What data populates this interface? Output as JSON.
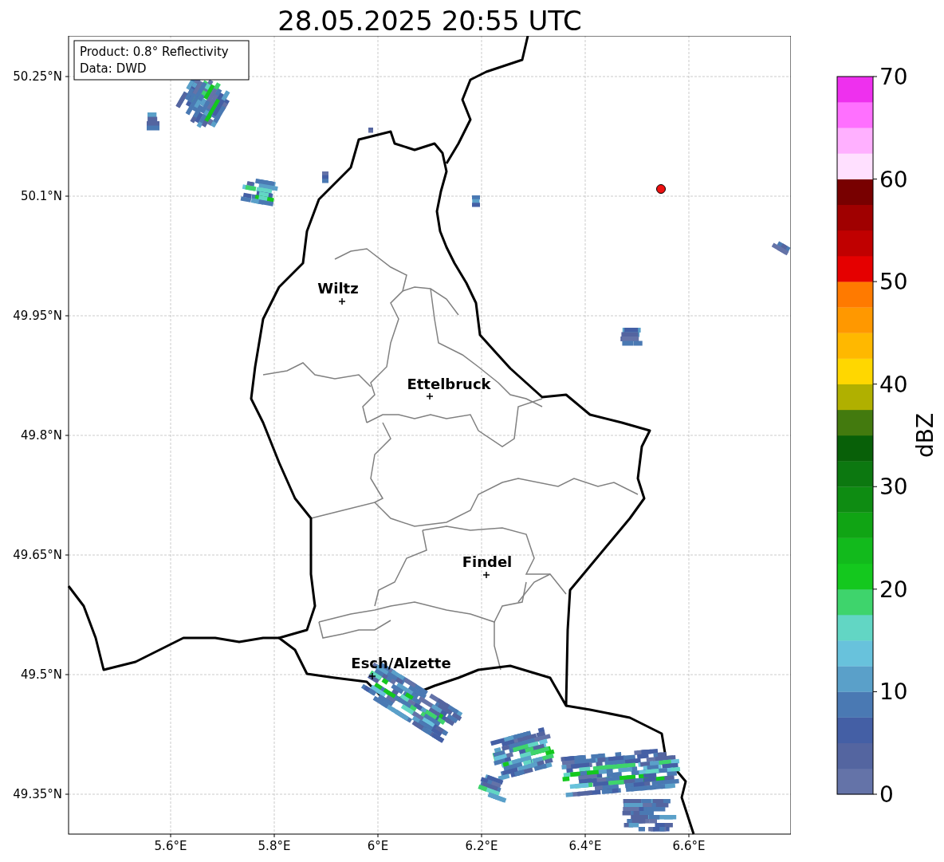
{
  "title": "28.05.2025 20:55 UTC",
  "info_box": [
    "Product: 0.8° Reflectivity",
    "Data: DWD"
  ],
  "map": {
    "lat_labels": [
      "50.25°N",
      "50.1°N",
      "49.95°N",
      "49.8°N",
      "49.65°N",
      "49.5°N",
      "49.35°N"
    ],
    "lon_labels": [
      "5.6°E",
      "5.8°E",
      "6°E",
      "6.2°E",
      "6.4°E",
      "6.6°E"
    ],
    "cities": [
      {
        "name": "Wiltz"
      },
      {
        "name": "Ettelbruck"
      },
      {
        "name": "Findel"
      },
      {
        "name": "Esch/Alzette"
      }
    ]
  },
  "colorbar": {
    "label": "dBZ",
    "ticks": [
      "70",
      "60",
      "50",
      "40",
      "30",
      "20",
      "10",
      "0"
    ],
    "segments": [
      {
        "color": "#6473a8"
      },
      {
        "color": "#5465a0"
      },
      {
        "color": "#445fa5"
      },
      {
        "color": "#4a79b3"
      },
      {
        "color": "#5aa0c9"
      },
      {
        "color": "#68c2dc"
      },
      {
        "color": "#62d6c4"
      },
      {
        "color": "#3ed46c"
      },
      {
        "color": "#14c81e"
      },
      {
        "color": "#12ba1c"
      },
      {
        "color": "#10a414"
      },
      {
        "color": "#0e8c12"
      },
      {
        "color": "#0c7810"
      },
      {
        "color": "#086008"
      },
      {
        "color": "#437a0e"
      },
      {
        "color": "#b0b000"
      },
      {
        "color": "#ffd700"
      },
      {
        "color": "#ffb800"
      },
      {
        "color": "#ff9800"
      },
      {
        "color": "#ff7a00"
      },
      {
        "color": "#e50000"
      },
      {
        "color": "#c00000"
      },
      {
        "color": "#a00000"
      },
      {
        "color": "#780000"
      },
      {
        "color": "#ffe0ff"
      },
      {
        "color": "#ffb0ff"
      },
      {
        "color": "#ff70ff"
      },
      {
        "color": "#ee30ee"
      }
    ]
  }
}
